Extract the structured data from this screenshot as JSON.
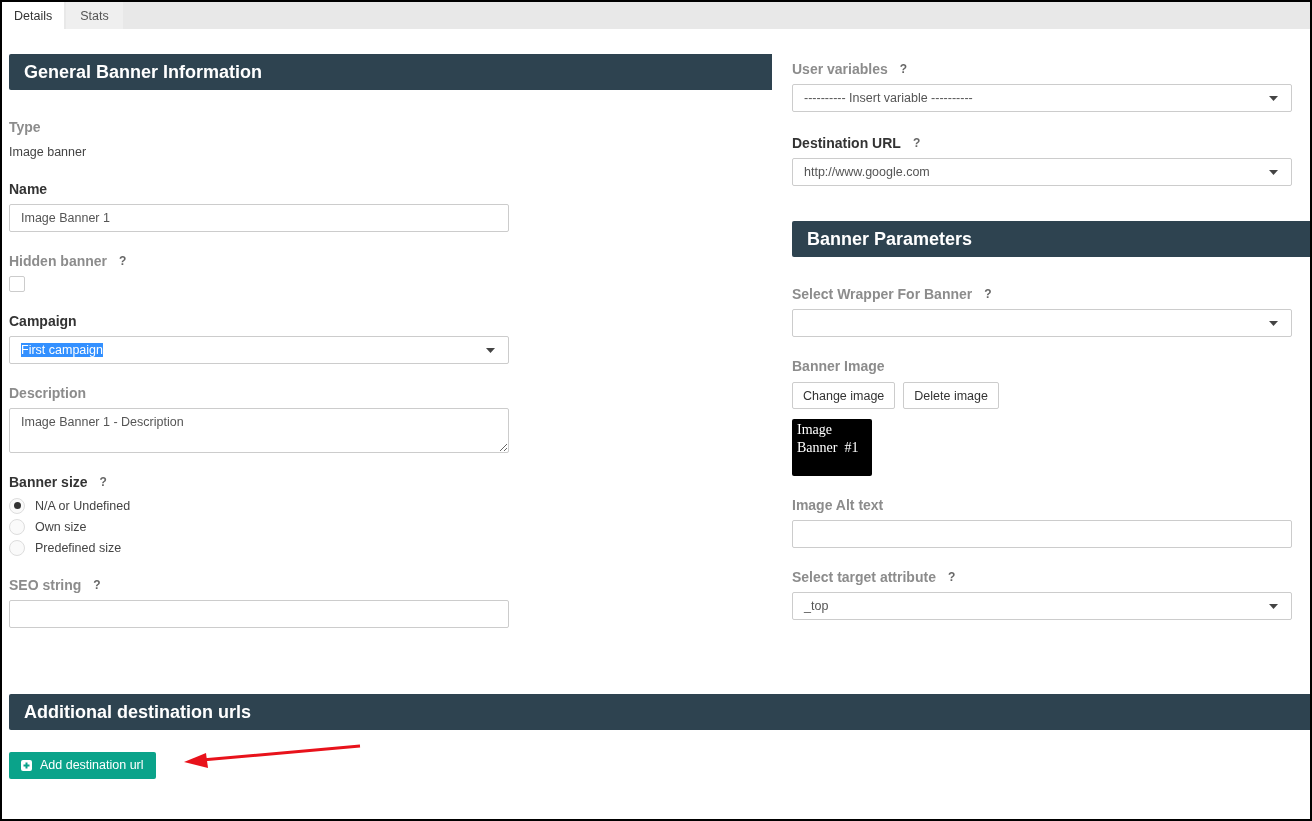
{
  "tabs": [
    {
      "label": "Details",
      "selected": true
    },
    {
      "label": "Stats",
      "selected": false
    }
  ],
  "general": {
    "title": "General Banner Information",
    "fields": [
      {
        "kind": "static",
        "label": "Type",
        "required": false,
        "value": "Image banner"
      },
      {
        "kind": "text",
        "label": "Name",
        "required": true,
        "value": "Image Banner 1"
      },
      {
        "kind": "checkbox",
        "label": "Hidden banner",
        "required": false,
        "help": "?",
        "checked": false
      },
      {
        "kind": "select",
        "label": "Campaign",
        "required": true,
        "value": "First campaign",
        "highlighted": true
      },
      {
        "kind": "textarea",
        "label": "Description",
        "required": false,
        "value": "Image Banner 1 - Description"
      },
      {
        "kind": "radio",
        "label": "Banner size",
        "required": true,
        "help": "?",
        "options": [
          {
            "label": "N/A or Undefined",
            "selected": true
          },
          {
            "label": "Own size",
            "selected": false
          },
          {
            "label": "Predefined size",
            "selected": false
          }
        ]
      },
      {
        "kind": "text",
        "label": "SEO string",
        "required": false,
        "help": "?"
      }
    ]
  },
  "destination": {
    "fields": [
      {
        "kind": "select",
        "label": "User variables",
        "required": false,
        "help": "?",
        "value": "----------  Insert variable  ----------",
        "highlighted": false
      },
      {
        "kind": "select",
        "label": "Destination URL",
        "required": true,
        "help": "?",
        "value": "http://www.google.com",
        "highlighted": false
      }
    ]
  },
  "parameters": {
    "title": "Banner Parameters",
    "fields": [
      {
        "kind": "select",
        "label": "Select Wrapper For Banner",
        "required": false,
        "help": "?"
      },
      {
        "kind": "image",
        "label": "Banner Image",
        "required": false,
        "buttons": [
          "Change image",
          "Delete image"
        ],
        "preview": "Image Banner  #1"
      },
      {
        "kind": "text",
        "label": "Image Alt text",
        "required": false
      },
      {
        "kind": "select",
        "label": "Select target attribute",
        "required": false,
        "help": "?",
        "value": "_top",
        "highlighted": false
      }
    ]
  },
  "additional": {
    "title": "Additional destination urls",
    "button": "Add destination url"
  }
}
